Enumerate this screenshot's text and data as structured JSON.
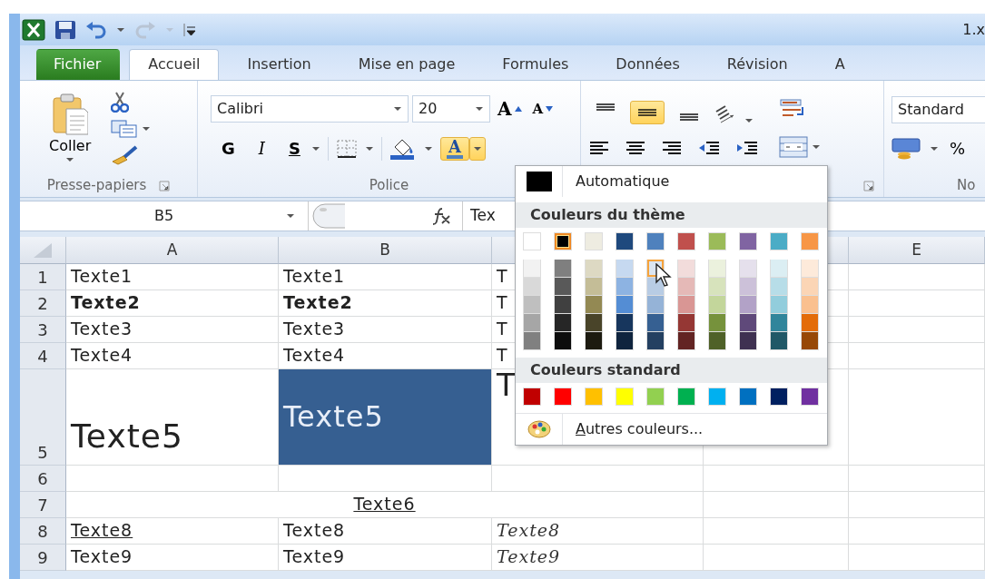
{
  "window": {
    "title": "1.x"
  },
  "quick_access": {
    "redo_disabled": true
  },
  "tabs": [
    {
      "label": "Fichier",
      "kind": "file",
      "selected": false
    },
    {
      "label": "Accueil",
      "kind": "tab",
      "selected": true
    },
    {
      "label": "Insertion",
      "kind": "tab",
      "selected": false
    },
    {
      "label": "Mise en page",
      "kind": "tab",
      "selected": false
    },
    {
      "label": "Formules",
      "kind": "tab",
      "selected": false
    },
    {
      "label": "Données",
      "kind": "tab",
      "selected": false
    },
    {
      "label": "Révision",
      "kind": "tab",
      "selected": false
    },
    {
      "label": "A",
      "kind": "tab",
      "selected": false
    }
  ],
  "ribbon": {
    "clipboard": {
      "paste_label": "Coller",
      "group_label": "Presse-papiers"
    },
    "font": {
      "font_name": "Calibri",
      "font_size": "20",
      "grow_label": "A",
      "shrink_label": "A",
      "bold_label": "G",
      "italic_label": "I",
      "underline_label": "S",
      "font_color_label": "A",
      "font_color_open": true,
      "group_label": "Police"
    },
    "alignment": {
      "vertical": [
        {
          "kind": "top",
          "selected": false
        },
        {
          "kind": "middle",
          "selected": true
        },
        {
          "kind": "bottom",
          "selected": false
        }
      ]
    },
    "number": {
      "format": "Standard",
      "percent_label": "%",
      "group_label": "No"
    }
  },
  "formula_bar": {
    "name_box": "B5",
    "content": "Tex"
  },
  "sheet": {
    "columns": [
      {
        "label": "A"
      },
      {
        "label": "B"
      },
      {},
      {},
      {
        "label": "E"
      }
    ],
    "rows": [
      {
        "header": "1",
        "cells": [
          {
            "text": "Texte1",
            "kind": "plain"
          },
          {
            "text": "Texte1",
            "kind": "plain"
          },
          {
            "text": "T",
            "kind": "plain"
          },
          {},
          {}
        ]
      },
      {
        "header": "2",
        "cells": [
          {
            "text": "Texte2",
            "kind": "bold"
          },
          {
            "text": "Texte2",
            "kind": "bold"
          },
          {
            "text": "T",
            "kind": "plain"
          },
          {},
          {}
        ]
      },
      {
        "header": "3",
        "cells": [
          {
            "text": "Texte3",
            "kind": "plain"
          },
          {
            "text": "Texte3",
            "kind": "plain"
          },
          {
            "text": "T",
            "kind": "plain"
          },
          {},
          {}
        ]
      },
      {
        "header": "4",
        "cells": [
          {
            "text": "Texte4",
            "kind": "plain"
          },
          {
            "text": "Texte4",
            "kind": "plain"
          },
          {
            "text": "T",
            "kind": "plain"
          },
          {},
          {}
        ]
      },
      {
        "header": "5",
        "cells": [
          {
            "text": "Texte5",
            "kind": "large"
          },
          {
            "text": "Texte5",
            "kind": "filled"
          },
          {
            "text": "T",
            "kind": "top"
          },
          {},
          {}
        ]
      },
      {
        "header": "6",
        "cells": [
          {},
          {},
          {},
          {},
          {}
        ]
      },
      {
        "header": "7",
        "cells": [
          {
            "text": "Texte6",
            "kind": "centered"
          },
          {},
          {}
        ]
      },
      {
        "header": "8",
        "cells": [
          {
            "text": "Texte8",
            "kind": "underline"
          },
          {
            "text": "Texte8",
            "kind": "plain"
          },
          {
            "text": "Texte8",
            "kind": "script"
          },
          {},
          {}
        ]
      },
      {
        "header": "9",
        "cells": [
          {
            "text": "Texte9",
            "kind": "plain"
          },
          {
            "text": "Texte9",
            "kind": "plain"
          },
          {
            "text": "Texte9",
            "kind": "script"
          },
          {},
          {}
        ]
      }
    ]
  },
  "color_menu": {
    "automatic_label": "Automatique",
    "theme_heading": "Couleurs du thème",
    "theme_colors": [
      {
        "color": "#ffffff",
        "selected": false
      },
      {
        "color": "#000000",
        "selected": true
      },
      {
        "color": "#eeece1",
        "selected": false
      },
      {
        "color": "#1f497d",
        "selected": false
      },
      {
        "color": "#4f81bd",
        "selected": false
      },
      {
        "color": "#c0504d",
        "selected": false
      },
      {
        "color": "#9bbb59",
        "selected": false
      },
      {
        "color": "#8064a2",
        "selected": false
      },
      {
        "color": "#4bacc6",
        "selected": false
      },
      {
        "color": "#f79646",
        "selected": false
      }
    ],
    "shades": [
      [
        {
          "color": "#f2f2f2",
          "hovered": false
        },
        {
          "color": "#d9d9d9",
          "hovered": false
        },
        {
          "color": "#bfbfbf",
          "hovered": false
        },
        {
          "color": "#a6a6a6",
          "hovered": false
        },
        {
          "color": "#808080",
          "hovered": false
        }
      ],
      [
        {
          "color": "#7f7f7f",
          "hovered": false
        },
        {
          "color": "#595959",
          "hovered": false
        },
        {
          "color": "#404040",
          "hovered": false
        },
        {
          "color": "#262626",
          "hovered": false
        },
        {
          "color": "#0d0d0d",
          "hovered": false
        }
      ],
      [
        {
          "color": "#ddd9c3",
          "hovered": false
        },
        {
          "color": "#c4bd97",
          "hovered": false
        },
        {
          "color": "#938953",
          "hovered": false
        },
        {
          "color": "#494429",
          "hovered": false
        },
        {
          "color": "#1d1b10",
          "hovered": false
        }
      ],
      [
        {
          "color": "#c6d9f0",
          "hovered": false
        },
        {
          "color": "#8db3e2",
          "hovered": false
        },
        {
          "color": "#548dd4",
          "hovered": false
        },
        {
          "color": "#17365d",
          "hovered": false
        },
        {
          "color": "#0f243e",
          "hovered": false
        }
      ],
      [
        {
          "color": "#dbe5f1",
          "hovered": true
        },
        {
          "color": "#b8cce4",
          "hovered": false
        },
        {
          "color": "#95b3d7",
          "hovered": false
        },
        {
          "color": "#366092",
          "hovered": false
        },
        {
          "color": "#244061",
          "hovered": false
        }
      ],
      [
        {
          "color": "#f2dcdb",
          "hovered": false
        },
        {
          "color": "#e5b9b7",
          "hovered": false
        },
        {
          "color": "#d99694",
          "hovered": false
        },
        {
          "color": "#953734",
          "hovered": false
        },
        {
          "color": "#632423",
          "hovered": false
        }
      ],
      [
        {
          "color": "#ebf1dd",
          "hovered": false
        },
        {
          "color": "#d7e3bc",
          "hovered": false
        },
        {
          "color": "#c3d69b",
          "hovered": false
        },
        {
          "color": "#76923c",
          "hovered": false
        },
        {
          "color": "#4f6128",
          "hovered": false
        }
      ],
      [
        {
          "color": "#e5e0ec",
          "hovered": false
        },
        {
          "color": "#ccc1d9",
          "hovered": false
        },
        {
          "color": "#b2a2c7",
          "hovered": false
        },
        {
          "color": "#5f497a",
          "hovered": false
        },
        {
          "color": "#3f3151",
          "hovered": false
        }
      ],
      [
        {
          "color": "#dbeef3",
          "hovered": false
        },
        {
          "color": "#b7dde8",
          "hovered": false
        },
        {
          "color": "#92cddc",
          "hovered": false
        },
        {
          "color": "#31859b",
          "hovered": false
        },
        {
          "color": "#205867",
          "hovered": false
        }
      ],
      [
        {
          "color": "#fdeada",
          "hovered": false
        },
        {
          "color": "#fbd5b5",
          "hovered": false
        },
        {
          "color": "#fac08f",
          "hovered": false
        },
        {
          "color": "#e36c09",
          "hovered": false
        },
        {
          "color": "#974806",
          "hovered": false
        }
      ]
    ],
    "standard_heading": "Couleurs standard",
    "standard_colors": [
      {
        "color": "#c00000"
      },
      {
        "color": "#ff0000"
      },
      {
        "color": "#ffc000"
      },
      {
        "color": "#ffff00"
      },
      {
        "color": "#92d050"
      },
      {
        "color": "#00b050"
      },
      {
        "color": "#00b0f0"
      },
      {
        "color": "#0070c0"
      },
      {
        "color": "#002060"
      },
      {
        "color": "#7030a0"
      }
    ],
    "more_label": "Autres couleurs..."
  }
}
